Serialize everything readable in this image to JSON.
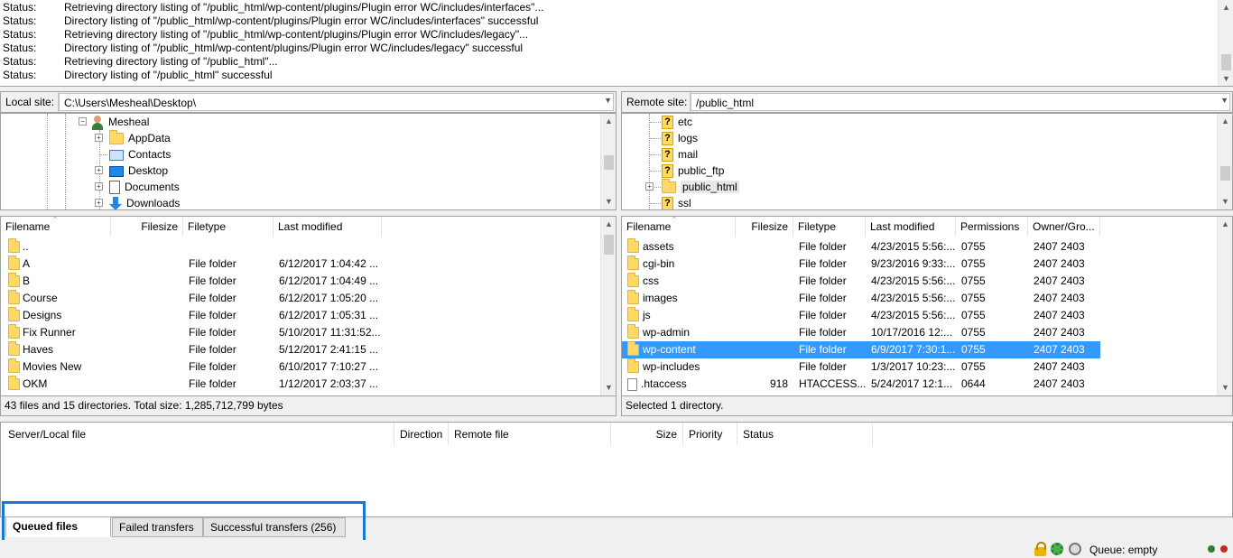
{
  "log": {
    "lines": [
      {
        "label": "Status:",
        "text": "Retrieving directory listing of \"/public_html/wp-content/plugins/Plugin error WC/includes/interfaces\"..."
      },
      {
        "label": "Status:",
        "text": "Directory listing of \"/public_html/wp-content/plugins/Plugin error WC/includes/interfaces\" successful"
      },
      {
        "label": "Status:",
        "text": "Retrieving directory listing of \"/public_html/wp-content/plugins/Plugin error WC/includes/legacy\"..."
      },
      {
        "label": "Status:",
        "text": "Directory listing of \"/public_html/wp-content/plugins/Plugin error WC/includes/legacy\" successful"
      },
      {
        "label": "Status:",
        "text": "Retrieving directory listing of \"/public_html\"..."
      },
      {
        "label": "Status:",
        "text": "Directory listing of \"/public_html\" successful"
      }
    ]
  },
  "local": {
    "site_label": "Local site:",
    "path": "C:\\Users\\Mesheal\\Desktop\\",
    "tree": [
      "Mesheal",
      "AppData",
      "Contacts",
      "Desktop",
      "Documents",
      "Downloads"
    ],
    "columns": [
      "Filename",
      "Filesize",
      "Filetype",
      "Last modified"
    ],
    "rows": [
      {
        "name": "..",
        "size": "",
        "type": "",
        "modified": ""
      },
      {
        "name": "A",
        "size": "",
        "type": "File folder",
        "modified": "6/12/2017 1:04:42 ..."
      },
      {
        "name": "B",
        "size": "",
        "type": "File folder",
        "modified": "6/12/2017 1:04:49 ..."
      },
      {
        "name": "Course",
        "size": "",
        "type": "File folder",
        "modified": "6/12/2017 1:05:20 ..."
      },
      {
        "name": "Designs",
        "size": "",
        "type": "File folder",
        "modified": "6/12/2017 1:05:31 ..."
      },
      {
        "name": "Fix Runner",
        "size": "",
        "type": "File folder",
        "modified": "5/10/2017 11:31:52..."
      },
      {
        "name": "Haves",
        "size": "",
        "type": "File folder",
        "modified": "5/12/2017 2:41:15 ..."
      },
      {
        "name": "Movies New",
        "size": "",
        "type": "File folder",
        "modified": "6/10/2017 7:10:27 ..."
      },
      {
        "name": "OKM",
        "size": "",
        "type": "File folder",
        "modified": "1/12/2017 2:03:37 ..."
      }
    ],
    "status": "43 files and 15 directories. Total size: 1,285,712,799 bytes"
  },
  "remote": {
    "site_label": "Remote site:",
    "path": "/public_html",
    "tree": [
      "etc",
      "logs",
      "mail",
      "public_ftp",
      "public_html",
      "ssl"
    ],
    "columns": [
      "Filename",
      "Filesize",
      "Filetype",
      "Last modified",
      "Permissions",
      "Owner/Gro..."
    ],
    "rows": [
      {
        "name": "assets",
        "size": "",
        "type": "File folder",
        "modified": "4/23/2015 5:56:...",
        "perm": "0755",
        "owner": "2407 2403"
      },
      {
        "name": "cgi-bin",
        "size": "",
        "type": "File folder",
        "modified": "9/23/2016 9:33:...",
        "perm": "0755",
        "owner": "2407 2403"
      },
      {
        "name": "css",
        "size": "",
        "type": "File folder",
        "modified": "4/23/2015 5:56:...",
        "perm": "0755",
        "owner": "2407 2403"
      },
      {
        "name": "images",
        "size": "",
        "type": "File folder",
        "modified": "4/23/2015 5:56:...",
        "perm": "0755",
        "owner": "2407 2403"
      },
      {
        "name": "js",
        "size": "",
        "type": "File folder",
        "modified": "4/23/2015 5:56:...",
        "perm": "0755",
        "owner": "2407 2403"
      },
      {
        "name": "wp-admin",
        "size": "",
        "type": "File folder",
        "modified": "10/17/2016 12:...",
        "perm": "0755",
        "owner": "2407 2403"
      },
      {
        "name": "wp-content",
        "size": "",
        "type": "File folder",
        "modified": "6/9/2017 7:30:1...",
        "perm": "0755",
        "owner": "2407 2403"
      },
      {
        "name": "wp-includes",
        "size": "",
        "type": "File folder",
        "modified": "1/3/2017 10:23:...",
        "perm": "0755",
        "owner": "2407 2403"
      },
      {
        "name": ".htaccess",
        "size": "918",
        "type": "HTACCESS...",
        "modified": "5/24/2017 12:1...",
        "perm": "0644",
        "owner": "2407 2403"
      }
    ],
    "selected_index": 6,
    "status": "Selected 1 directory."
  },
  "queue": {
    "columns": [
      "Server/Local file",
      "Direction",
      "Remote file",
      "Size",
      "Priority",
      "Status"
    ],
    "tabs": [
      "Queued files",
      "Failed transfers",
      "Successful transfers (256)"
    ],
    "active_tab": 0
  },
  "statusbar": {
    "queue_text": "Queue: empty",
    "led_colors": [
      "#2e7d32",
      "#c62828"
    ]
  },
  "colors": {
    "selection": "#3399ff",
    "highlight_border": "#1976d2"
  }
}
